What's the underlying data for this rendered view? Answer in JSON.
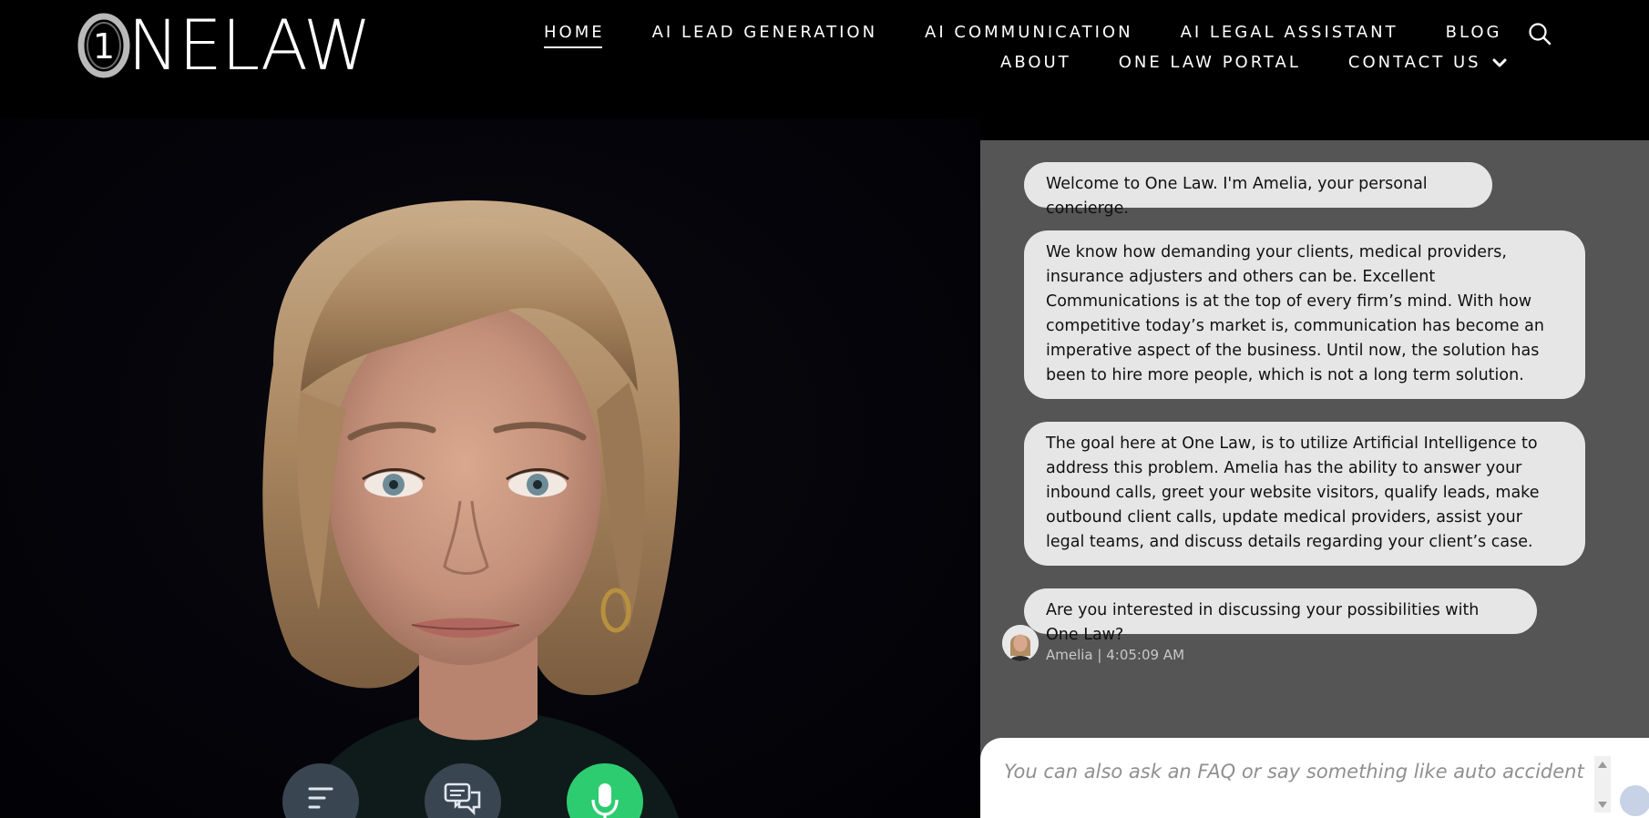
{
  "brand": {
    "logo_text": "NELAW",
    "logo_mark_digit": "1"
  },
  "nav": {
    "row1": [
      "HOME",
      "AI LEAD GENERATION",
      "AI COMMUNICATION",
      "AI LEGAL ASSISTANT",
      "BLOG"
    ],
    "row2": [
      "ABOUT",
      "ONE LAW PORTAL",
      "CONTACT US"
    ],
    "active": "HOME"
  },
  "chat": {
    "messages": [
      "Welcome to One Law. I'm Amelia, your personal concierge.",
      "We know how demanding your clients, medical providers, insurance adjusters and others can be. Excellent Communications is at the top of every firm’s mind. With how competitive today’s market is, communication has become an imperative aspect of the business. Until now, the solution has been to hire more people, which is not a long term solution.",
      "The goal here at One Law, is to utilize Artificial Intelligence to address this problem. Amelia has the ability to answer your inbound calls, greet your website visitors, qualify leads, make outbound client calls, update medical providers, assist your legal teams, and discuss details regarding your client’s case.",
      "Are you interested in discussing your possibilities with One Law?"
    ],
    "meta": "Amelia | 4:05:09 AM",
    "input_placeholder": "You can also ask an FAQ or say something like auto accident",
    "input_value": ""
  },
  "colors": {
    "background": "#000000",
    "chat_panel": "#555555",
    "bubble": "#e6e6e6",
    "mic_button": "#2ecc71",
    "control_button": "#3a4552"
  },
  "icons": {
    "search": "search-icon",
    "chevron": "chevron-down-icon",
    "menu": "menu-lines-icon",
    "chat": "chat-bubbles-icon",
    "mic": "microphone-icon"
  }
}
